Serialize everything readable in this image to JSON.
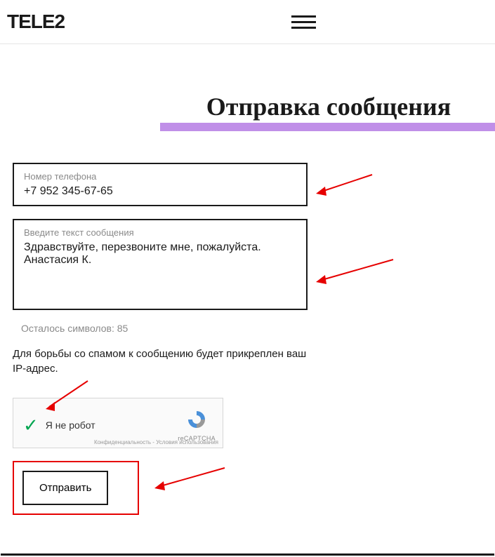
{
  "header": {
    "logo": "TELE2"
  },
  "title": "Отправка сообщения",
  "phone": {
    "label": "Номер телефона",
    "value": "+7 952 345-67-65"
  },
  "message": {
    "label": "Введите текст сообщения",
    "value": "Здравствуйте, перезвоните мне, пожалуйста. Анастасия К."
  },
  "charsLeft": "Осталось символов: 85",
  "info": "Для борьбы со спамом к сообщению будет прикреплен ваш IP-адрес.",
  "captcha": {
    "label": "Я не робот",
    "brand": "reCAPTCHA",
    "footer": "Конфиденциальность - Условия использования"
  },
  "submit": "Отправить"
}
